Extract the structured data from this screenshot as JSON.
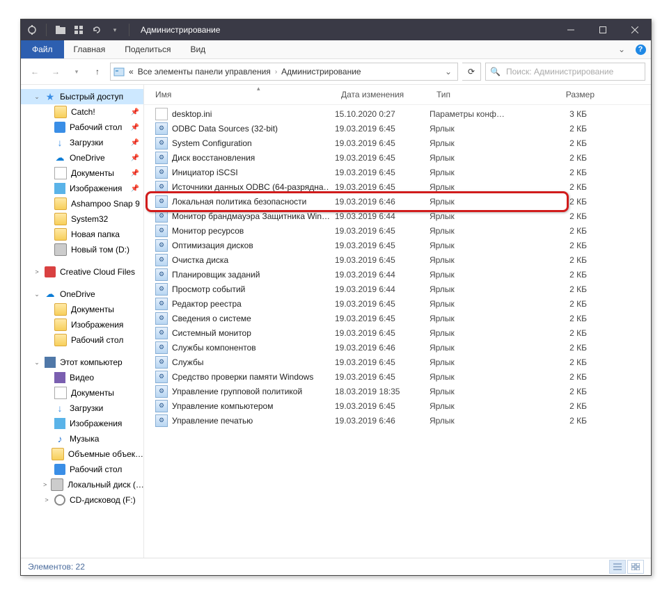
{
  "titlebar": {
    "title": "Администрирование"
  },
  "ribbon": {
    "file": "Файл",
    "tabs": [
      "Главная",
      "Поделиться",
      "Вид"
    ]
  },
  "nav": {
    "crumb_sep": "«",
    "crumb1": "Все элементы панели управления",
    "crumb2": "Администрирование",
    "search_placeholder": "Поиск: Администрирование"
  },
  "columns": {
    "name": "Имя",
    "date": "Дата изменения",
    "type": "Тип",
    "size": "Размер"
  },
  "sidebar": [
    {
      "label": "Быстрый доступ",
      "icon": "star",
      "active": true,
      "exp": "⌄",
      "lvl": 1
    },
    {
      "label": "Catch!",
      "icon": "folder",
      "pin": true,
      "lvl": 2
    },
    {
      "label": "Рабочий стол",
      "icon": "desktop",
      "pin": true,
      "lvl": 2
    },
    {
      "label": "Загрузки",
      "icon": "download",
      "pin": true,
      "lvl": 2
    },
    {
      "label": "OneDrive",
      "icon": "onedrive",
      "pin": true,
      "lvl": 2
    },
    {
      "label": "Документы",
      "icon": "doc",
      "pin": true,
      "lvl": 2
    },
    {
      "label": "Изображения",
      "icon": "img",
      "pin": true,
      "lvl": 2
    },
    {
      "label": "Ashampoo Snap 9",
      "icon": "folder",
      "lvl": 2
    },
    {
      "label": "System32",
      "icon": "folder",
      "lvl": 2
    },
    {
      "label": "Новая папка",
      "icon": "folder",
      "lvl": 2
    },
    {
      "label": "Новый том (D:)",
      "icon": "drive",
      "lvl": 2
    },
    {
      "spacer": true
    },
    {
      "label": "Creative Cloud Files",
      "icon": "cc",
      "exp": ">",
      "lvl": 1
    },
    {
      "spacer": true
    },
    {
      "label": "OneDrive",
      "icon": "onedrive",
      "exp": "⌄",
      "lvl": 1
    },
    {
      "label": "Документы",
      "icon": "folder",
      "lvl": 2
    },
    {
      "label": "Изображения",
      "icon": "folder",
      "lvl": 2
    },
    {
      "label": "Рабочий стол",
      "icon": "folder",
      "lvl": 2
    },
    {
      "spacer": true
    },
    {
      "label": "Этот компьютер",
      "icon": "pc",
      "exp": "⌄",
      "lvl": 1
    },
    {
      "label": "Видео",
      "icon": "video",
      "lvl": 2
    },
    {
      "label": "Документы",
      "icon": "doc",
      "lvl": 2
    },
    {
      "label": "Загрузки",
      "icon": "download",
      "lvl": 2
    },
    {
      "label": "Изображения",
      "icon": "img",
      "lvl": 2
    },
    {
      "label": "Музыка",
      "icon": "music",
      "lvl": 2
    },
    {
      "label": "Объемные объек…",
      "icon": "folder",
      "lvl": 2
    },
    {
      "label": "Рабочий стол",
      "icon": "desktop",
      "lvl": 2
    },
    {
      "label": "Локальный диск (…",
      "icon": "drive",
      "exp": ">",
      "lvl": 2
    },
    {
      "label": "CD-дисковод (F:)",
      "icon": "cd",
      "exp": ">",
      "lvl": 2
    }
  ],
  "files": [
    {
      "name": "desktop.ini",
      "date": "15.10.2020 0:27",
      "type": "Параметры конф…",
      "size": "3 КБ",
      "icon": "file"
    },
    {
      "name": "ODBC Data Sources (32-bit)",
      "date": "19.03.2019 6:45",
      "type": "Ярлык",
      "size": "2 КБ",
      "icon": "shortcut"
    },
    {
      "name": "System Configuration",
      "date": "19.03.2019 6:45",
      "type": "Ярлык",
      "size": "2 КБ",
      "icon": "shortcut"
    },
    {
      "name": "Диск восстановления",
      "date": "19.03.2019 6:45",
      "type": "Ярлык",
      "size": "2 КБ",
      "icon": "shortcut"
    },
    {
      "name": "Инициатор iSCSI",
      "date": "19.03.2019 6:45",
      "type": "Ярлык",
      "size": "2 КБ",
      "icon": "shortcut"
    },
    {
      "name": "Источники данных ODBC (64-разрядна…",
      "date": "19.03.2019 6:45",
      "type": "Ярлык",
      "size": "2 КБ",
      "icon": "shortcut"
    },
    {
      "name": "Локальная политика безопасности",
      "date": "19.03.2019 6:46",
      "type": "Ярлык",
      "size": "2 КБ",
      "icon": "shortcut",
      "highlight": true
    },
    {
      "name": "Монитор брандмауэра Защитника Win…",
      "date": "19.03.2019 6:44",
      "type": "Ярлык",
      "size": "2 КБ",
      "icon": "shortcut"
    },
    {
      "name": "Монитор ресурсов",
      "date": "19.03.2019 6:45",
      "type": "Ярлык",
      "size": "2 КБ",
      "icon": "shortcut"
    },
    {
      "name": "Оптимизация дисков",
      "date": "19.03.2019 6:45",
      "type": "Ярлык",
      "size": "2 КБ",
      "icon": "shortcut"
    },
    {
      "name": "Очистка диска",
      "date": "19.03.2019 6:45",
      "type": "Ярлык",
      "size": "2 КБ",
      "icon": "shortcut"
    },
    {
      "name": "Планировщик заданий",
      "date": "19.03.2019 6:44",
      "type": "Ярлык",
      "size": "2 КБ",
      "icon": "shortcut"
    },
    {
      "name": "Просмотр событий",
      "date": "19.03.2019 6:44",
      "type": "Ярлык",
      "size": "2 КБ",
      "icon": "shortcut"
    },
    {
      "name": "Редактор реестра",
      "date": "19.03.2019 6:45",
      "type": "Ярлык",
      "size": "2 КБ",
      "icon": "shortcut"
    },
    {
      "name": "Сведения о системе",
      "date": "19.03.2019 6:45",
      "type": "Ярлык",
      "size": "2 КБ",
      "icon": "shortcut"
    },
    {
      "name": "Системный монитор",
      "date": "19.03.2019 6:45",
      "type": "Ярлык",
      "size": "2 КБ",
      "icon": "shortcut"
    },
    {
      "name": "Службы компонентов",
      "date": "19.03.2019 6:46",
      "type": "Ярлык",
      "size": "2 КБ",
      "icon": "shortcut"
    },
    {
      "name": "Службы",
      "date": "19.03.2019 6:45",
      "type": "Ярлык",
      "size": "2 КБ",
      "icon": "shortcut"
    },
    {
      "name": "Средство проверки памяти Windows",
      "date": "19.03.2019 6:45",
      "type": "Ярлык",
      "size": "2 КБ",
      "icon": "shortcut"
    },
    {
      "name": "Управление групповой политикой",
      "date": "18.03.2019 18:35",
      "type": "Ярлык",
      "size": "2 КБ",
      "icon": "shortcut"
    },
    {
      "name": "Управление компьютером",
      "date": "19.03.2019 6:45",
      "type": "Ярлык",
      "size": "2 КБ",
      "icon": "shortcut"
    },
    {
      "name": "Управление печатью",
      "date": "19.03.2019 6:46",
      "type": "Ярлык",
      "size": "2 КБ",
      "icon": "shortcut"
    }
  ],
  "status": {
    "text": "Элементов: 22"
  }
}
